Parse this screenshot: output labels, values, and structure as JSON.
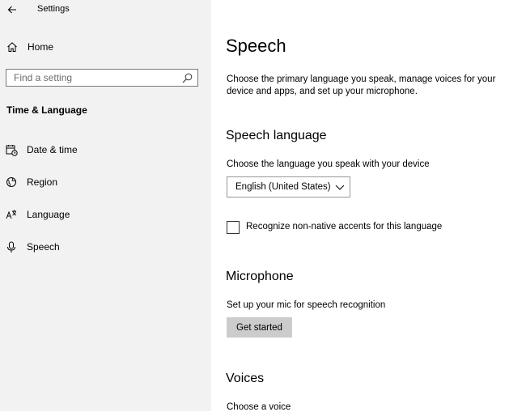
{
  "window": {
    "title": "Settings",
    "controls": [
      "minimize-icon",
      "maximize-icon",
      "close-icon"
    ]
  },
  "sidebar": {
    "back_icon": "back-arrow-icon",
    "home": {
      "label": "Home",
      "icon": "home-icon"
    },
    "search": {
      "placeholder": "Find a setting",
      "value": "",
      "icon": "search-icon"
    },
    "section_title": "Time & Language",
    "items": [
      {
        "label": "Date & time",
        "icon": "calendar-clock-icon"
      },
      {
        "label": "Region",
        "icon": "globe-icon"
      },
      {
        "label": "Language",
        "icon": "language-icon"
      },
      {
        "label": "Speech",
        "icon": "microphone-icon"
      }
    ]
  },
  "main": {
    "title": "Speech",
    "intro": "Choose the primary language you speak, manage voices for your device and apps, and set up your microphone.",
    "speech_language": {
      "heading": "Speech language",
      "description": "Choose the language you speak with your device",
      "selected": "English (United States)",
      "checkbox_label": "Recognize non-native accents for this language",
      "checkbox_checked": false
    },
    "microphone": {
      "heading": "Microphone",
      "description": "Set up your mic for speech recognition",
      "button_label": "Get started"
    },
    "voices": {
      "heading": "Voices",
      "description": "Choose a voice"
    }
  },
  "colors": {
    "sidebar_bg": "#f2f2f2",
    "main_bg": "#ffffff",
    "button_bg": "#cccccc"
  }
}
